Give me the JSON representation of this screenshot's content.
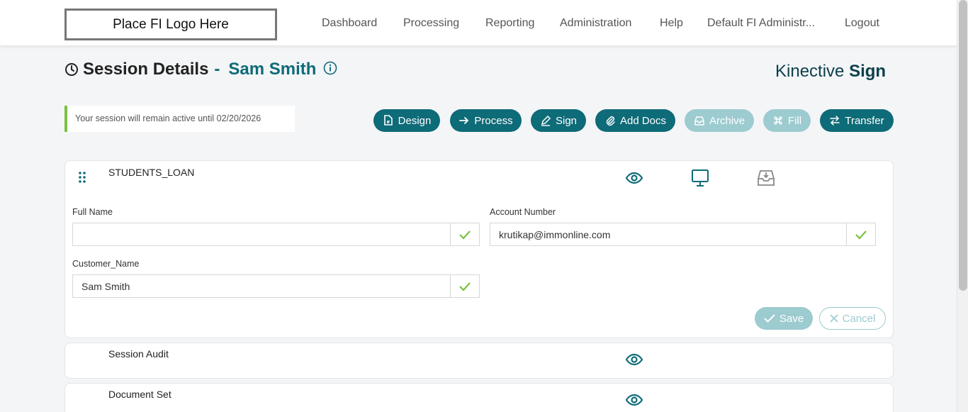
{
  "header": {
    "logo_text": "Place FI Logo Here",
    "nav": [
      "Dashboard",
      "Processing",
      "Reporting",
      "Administration",
      "Help",
      "Default FI Administr...",
      "Logout"
    ]
  },
  "page": {
    "title": "Session Details",
    "separator": "-",
    "customer_name": "Sam Smith",
    "brand_light": "Kinective",
    "brand_bold": "Sign",
    "session_note": "Your session will remain active until 02/20/2026"
  },
  "actions": {
    "design": "Design",
    "process": "Process",
    "sign": "Sign",
    "add_docs": "Add Docs",
    "archive": "Archive",
    "fill": "Fill",
    "transfer": "Transfer"
  },
  "document": {
    "name": "STUDENTS_LOAN",
    "fields": {
      "full_name": {
        "label": "Full Name",
        "value": ""
      },
      "account_number": {
        "label": "Account Number",
        "value": "krutikap@immonline.com"
      },
      "customer_name": {
        "label": "Customer_Name",
        "value": "Sam Smith"
      }
    },
    "save_label": "Save",
    "cancel_label": "Cancel"
  },
  "sections": {
    "session_audit": "Session Audit",
    "document_set": "Document Set"
  },
  "colors": {
    "primary": "#0e6b78",
    "primary_disabled": "#9ccbd0",
    "success": "#7ac143",
    "icon_gray": "#888888"
  }
}
